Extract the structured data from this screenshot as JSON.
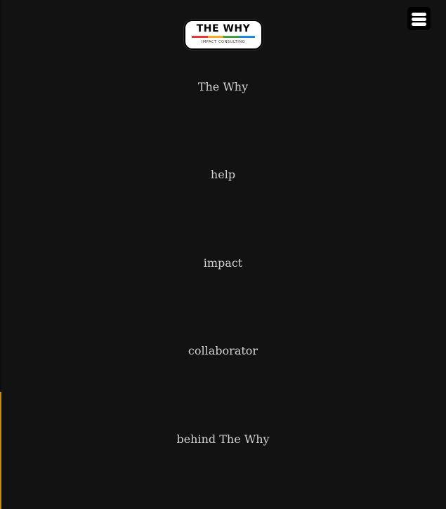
{
  "logo": {
    "title": "THE WHY",
    "subtitle": "IMPACT CONSULTING",
    "stripe_colors": [
      "#e53935",
      "#f9a825",
      "#43a047",
      "#1e88e5"
    ]
  },
  "menu_button": {
    "icon": "hamburger-menu-icon"
  },
  "nav": {
    "items": [
      {
        "label": "The Why"
      },
      {
        "label": "help"
      },
      {
        "label": "impact"
      },
      {
        "label": "collaborator"
      },
      {
        "label": "behind The Why"
      }
    ]
  },
  "colors": {
    "background": "#121212",
    "nav_text": "#d2d2d2",
    "edge_accent": "#b8901f"
  }
}
